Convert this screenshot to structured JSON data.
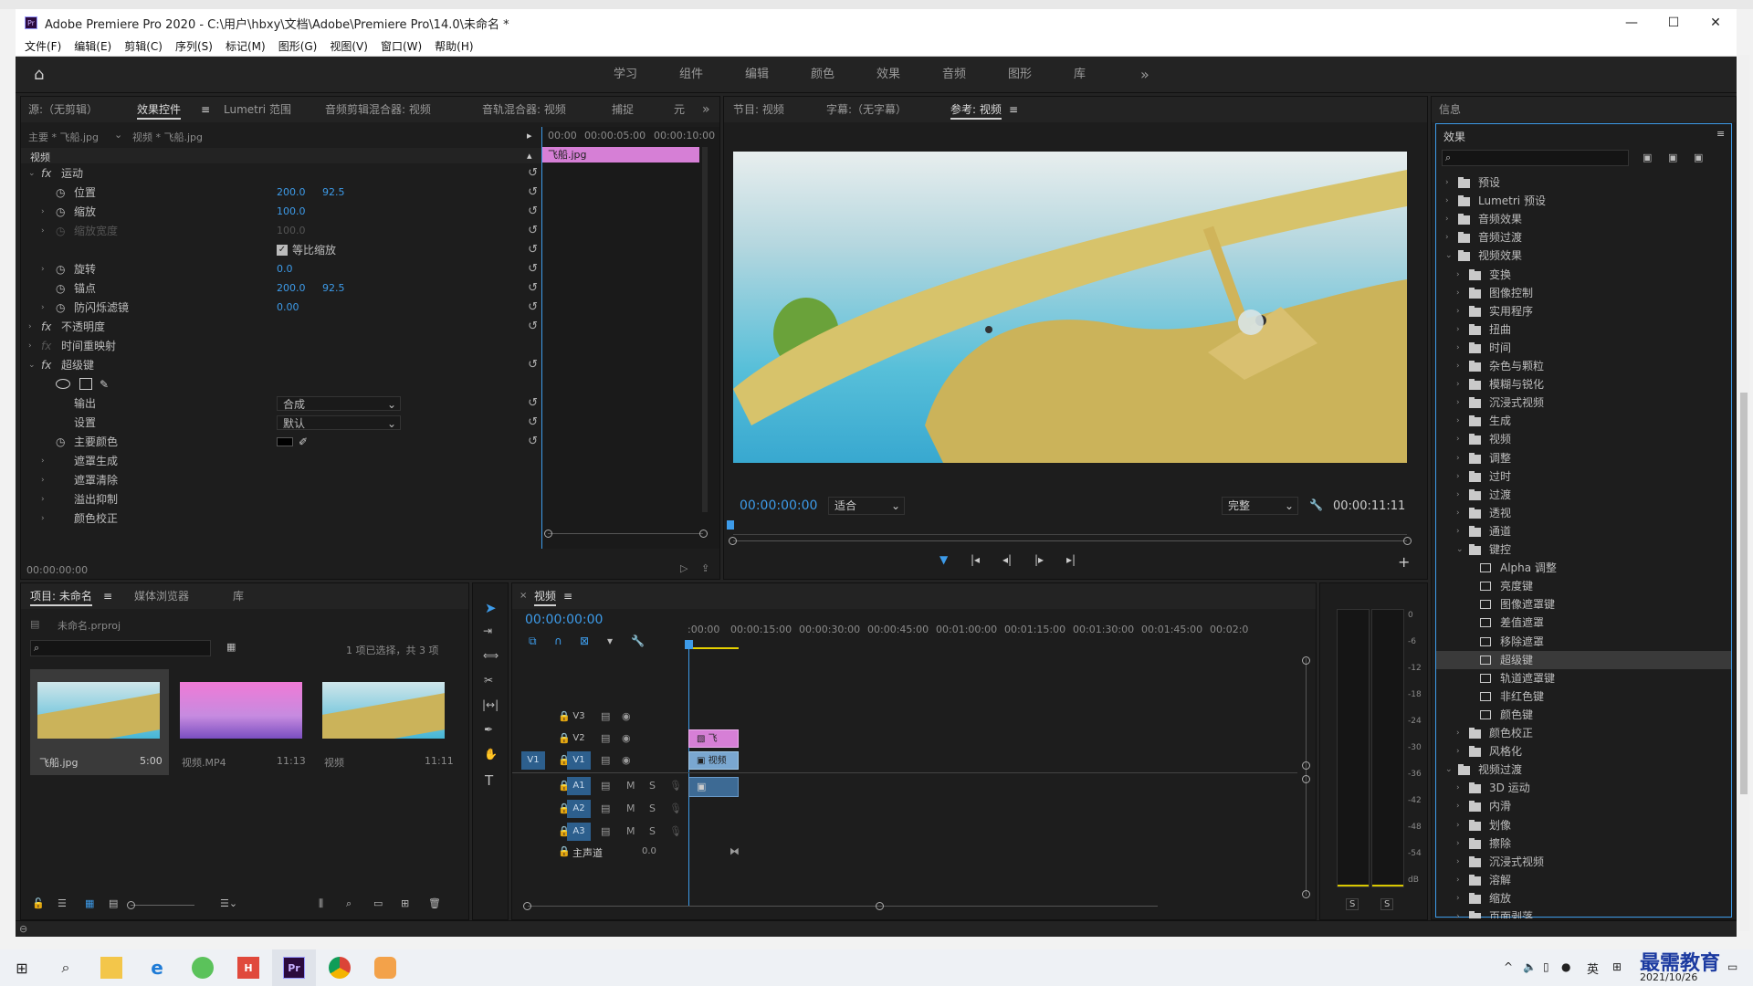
{
  "window": {
    "title": "Adobe Premiere Pro 2020 - C:\\用户\\hbxy\\文档\\Adobe\\Premiere Pro\\14.0\\未命名 *",
    "app_badge": "Pr"
  },
  "menu": [
    "文件(F)",
    "编辑(E)",
    "剪辑(C)",
    "序列(S)",
    "标记(M)",
    "图形(G)",
    "视图(V)",
    "窗口(W)",
    "帮助(H)"
  ],
  "workspaces": [
    "学习",
    "组件",
    "编辑",
    "颜色",
    "效果",
    "音频",
    "图形",
    "库"
  ],
  "source_tabs": [
    "源:（无剪辑）",
    "效果控件",
    "Lumetri 范围",
    "音频剪辑混合器: 视频",
    "音轨混合器: 视频",
    "捕捉",
    "元"
  ],
  "effect_controls": {
    "master": "主要 * 飞船.jpg",
    "clip": "视频 * 飞船.jpg",
    "section": "视频",
    "clip_bar": "飞船.jpg",
    "ruler": [
      "00:00",
      "00:00:05:00",
      "00:00:10:00"
    ],
    "timecode": "00:00:00:00",
    "rows": {
      "motion": "运动",
      "position": "位置",
      "position_x": "200.0",
      "position_y": "92.5",
      "scale": "缩放",
      "scale_v": "100.0",
      "scale_w": "缩放宽度",
      "scale_w_v": "100.0",
      "uniform": "等比缩放",
      "rotation": "旋转",
      "rotation_v": "0.0",
      "anchor": "锚点",
      "anchor_x": "200.0",
      "anchor_y": "92.5",
      "flicker": "防闪烁滤镜",
      "flicker_v": "0.00",
      "opacity": "不透明度",
      "remap": "时间重映射",
      "ultrakey": "超级键",
      "output": "输出",
      "output_v": "合成",
      "setting": "设置",
      "setting_v": "默认",
      "key_color": "主要颜色",
      "matte_gen": "遮罩生成",
      "matte_clean": "遮罩清除",
      "spill": "溢出抑制",
      "color_corr": "颜色校正"
    }
  },
  "program_tabs": [
    "节目: 视频",
    "字幕:（无字幕）",
    "参考: 视频"
  ],
  "program": {
    "timecode": "00:00:00:00",
    "fit": "适合",
    "quality": "完整",
    "duration": "00:00:11:11"
  },
  "info_tab": "信息",
  "effects_panel": {
    "title": "效果",
    "tree": [
      {
        "label": "预设",
        "level": 0,
        "open": false,
        "kind": "star"
      },
      {
        "label": "Lumetri 预设",
        "level": 0,
        "open": false,
        "kind": "star"
      },
      {
        "label": "音频效果",
        "level": 0,
        "open": false,
        "kind": "folder"
      },
      {
        "label": "音频过渡",
        "level": 0,
        "open": false,
        "kind": "folder"
      },
      {
        "label": "视频效果",
        "level": 0,
        "open": true,
        "kind": "folder"
      },
      {
        "label": "变换",
        "level": 1,
        "open": false,
        "kind": "folder"
      },
      {
        "label": "图像控制",
        "level": 1,
        "open": false,
        "kind": "folder"
      },
      {
        "label": "实用程序",
        "level": 1,
        "open": false,
        "kind": "folder"
      },
      {
        "label": "扭曲",
        "level": 1,
        "open": false,
        "kind": "folder"
      },
      {
        "label": "时间",
        "level": 1,
        "open": false,
        "kind": "folder"
      },
      {
        "label": "杂色与颗粒",
        "level": 1,
        "open": false,
        "kind": "folder"
      },
      {
        "label": "模糊与锐化",
        "level": 1,
        "open": false,
        "kind": "folder"
      },
      {
        "label": "沉浸式视频",
        "level": 1,
        "open": false,
        "kind": "folder"
      },
      {
        "label": "生成",
        "level": 1,
        "open": false,
        "kind": "folder"
      },
      {
        "label": "视频",
        "level": 1,
        "open": false,
        "kind": "folder"
      },
      {
        "label": "调整",
        "level": 1,
        "open": false,
        "kind": "folder"
      },
      {
        "label": "过时",
        "level": 1,
        "open": false,
        "kind": "folder"
      },
      {
        "label": "过渡",
        "level": 1,
        "open": false,
        "kind": "folder"
      },
      {
        "label": "透视",
        "level": 1,
        "open": false,
        "kind": "folder"
      },
      {
        "label": "通道",
        "level": 1,
        "open": false,
        "kind": "folder"
      },
      {
        "label": "键控",
        "level": 1,
        "open": true,
        "kind": "folder"
      },
      {
        "label": "Alpha 调整",
        "level": 2,
        "kind": "fx"
      },
      {
        "label": "亮度键",
        "level": 2,
        "kind": "fx"
      },
      {
        "label": "图像遮罩键",
        "level": 2,
        "kind": "fx"
      },
      {
        "label": "差值遮罩",
        "level": 2,
        "kind": "fx"
      },
      {
        "label": "移除遮罩",
        "level": 2,
        "kind": "fx"
      },
      {
        "label": "超级键",
        "level": 2,
        "kind": "fx",
        "selected": true
      },
      {
        "label": "轨道遮罩键",
        "level": 2,
        "kind": "fx"
      },
      {
        "label": "非红色键",
        "level": 2,
        "kind": "fx"
      },
      {
        "label": "颜色键",
        "level": 2,
        "kind": "fx"
      },
      {
        "label": "颜色校正",
        "level": 1,
        "open": false,
        "kind": "folder"
      },
      {
        "label": "风格化",
        "level": 1,
        "open": false,
        "kind": "folder"
      },
      {
        "label": "视频过渡",
        "level": 0,
        "open": true,
        "kind": "folder"
      },
      {
        "label": "3D 运动",
        "level": 1,
        "open": false,
        "kind": "folder"
      },
      {
        "label": "内滑",
        "level": 1,
        "open": false,
        "kind": "folder"
      },
      {
        "label": "划像",
        "level": 1,
        "open": false,
        "kind": "folder"
      },
      {
        "label": "擦除",
        "level": 1,
        "open": false,
        "kind": "folder"
      },
      {
        "label": "沉浸式视频",
        "level": 1,
        "open": false,
        "kind": "folder"
      },
      {
        "label": "溶解",
        "level": 1,
        "open": false,
        "kind": "folder"
      },
      {
        "label": "缩放",
        "level": 1,
        "open": false,
        "kind": "folder"
      },
      {
        "label": "页面剥落",
        "level": 1,
        "open": false,
        "kind": "folder"
      }
    ]
  },
  "project_tabs": [
    "项目: 未命名",
    "媒体浏览器",
    "库"
  ],
  "project": {
    "file": "未命名.prproj",
    "selection": "1 项已选择，共 3 项",
    "items": [
      {
        "name": "飞船.jpg",
        "dur": "5:00"
      },
      {
        "name": "视频.MP4",
        "dur": "11:13"
      },
      {
        "name": "视频",
        "dur": "11:11"
      }
    ]
  },
  "timeline": {
    "tab": "视频",
    "timecode": "00:00:00:00",
    "ruler": [
      ":00:00",
      "00:00:15:00",
      "00:00:30:00",
      "00:00:45:00",
      "00:01:00:00",
      "00:01:15:00",
      "00:01:30:00",
      "00:01:45:00",
      "00:02:0"
    ],
    "video_tracks": [
      "V3",
      "V2",
      "V1"
    ],
    "audio_tracks": [
      "A1",
      "A2",
      "A3"
    ],
    "source_v": "V1",
    "master": "主声道",
    "master_v": "0.0",
    "clip_v2": "飞",
    "clip_v1": "视频",
    "m": "M",
    "s": "S"
  },
  "meter": {
    "scale": [
      "0",
      "-6",
      "-12",
      "-18",
      "-24",
      "-30",
      "-36",
      "-42",
      "-48",
      "-54",
      "dB"
    ],
    "solo": [
      "S",
      "S"
    ]
  },
  "taskbar": {
    "ime": "英",
    "date": "2021/10/26",
    "watermark": "最需教育"
  }
}
